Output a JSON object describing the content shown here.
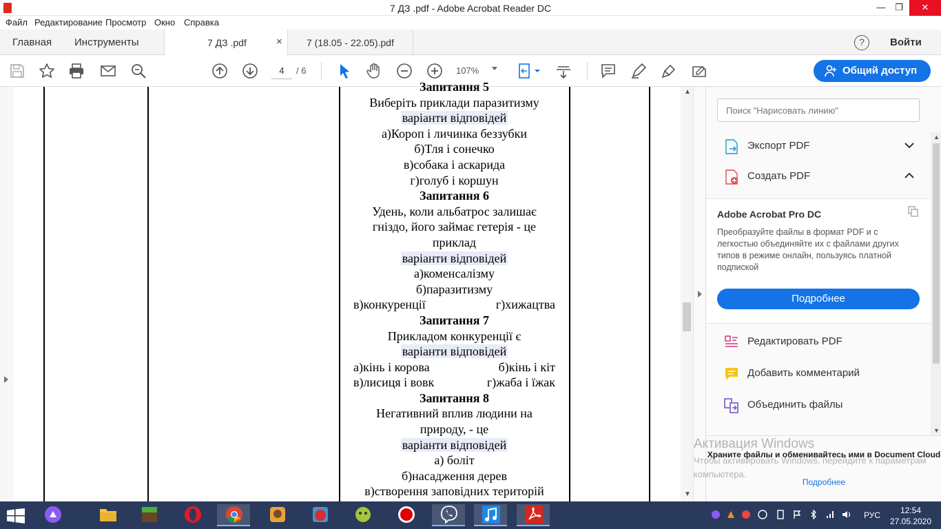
{
  "window": {
    "title": "7 ДЗ .pdf - Adobe Acrobat Reader DC"
  },
  "menu": [
    "Файл",
    "Редактирование",
    "Просмотр",
    "Окно",
    "Справка"
  ],
  "nav": {
    "home": "Главная",
    "tools": "Инструменты",
    "signin": "Войти",
    "help": "?"
  },
  "tabs": [
    {
      "label": "7 ДЗ .pdf",
      "close": "×"
    },
    {
      "label": "7 (18.05 - 22.05).pdf"
    }
  ],
  "toolbar": {
    "page_current": "4",
    "page_total": "/ 6",
    "zoom": "107%",
    "share_label": "Общий доступ"
  },
  "document": {
    "lines": [
      {
        "t": "Запитання 5",
        "b": true
      },
      {
        "t": "Виберіть приклади паразитизму"
      },
      {
        "t": "варіанти відповідей",
        "hl": true
      },
      {
        "t": "а)Короп і личинка беззубки"
      },
      {
        "t": "б)Тля і сонечко"
      },
      {
        "t": "в)собака і аскарида"
      },
      {
        "t": "г)голуб і коршун"
      },
      {
        "t": "Запитання 6",
        "b": true
      },
      {
        "t": "Удень, коли альбатрос залишає"
      },
      {
        "t": "гніздо, його займає гетерія - це"
      },
      {
        "t": "приклад"
      },
      {
        "t": "варіанти відповідей",
        "hl": true
      },
      {
        "t": "а)коменсалізму"
      },
      {
        "t": "б)паразитизму"
      },
      {
        "l": "в)конкуренції",
        "r": "г)хижацтва"
      },
      {
        "t": "Запитання 7",
        "b": true
      },
      {
        "t": "Прикладом конкуренції є"
      },
      {
        "t": "варіанти відповідей",
        "hl": true
      },
      {
        "l": "а)кінь і корова",
        "r": "б)кінь і кіт"
      },
      {
        "l": "в)лисиця і вовк",
        "r": "г)жаба і їжак"
      },
      {
        "t": "Запитання 8",
        "b": true
      },
      {
        "t": "Негативний вплив людини на"
      },
      {
        "t": "природу, - це"
      },
      {
        "t": "варіанти відповідей",
        "hl": true
      },
      {
        "t": "а) боліт"
      },
      {
        "t": "б)насадження дерев"
      },
      {
        "t": "в)створення заповідних територій"
      }
    ]
  },
  "right_panel": {
    "search_placeholder": "Поиск \"Нарисовать линию\"",
    "export_pdf": "Экспорт PDF",
    "create_pdf": "Создать PDF",
    "promo_title": "Adobe Acrobat Pro DC",
    "promo_desc": "Преобразуйте файлы в формат PDF и с легкостью объединяйте их с файлами других типов в режиме онлайн, пользуясь платной подпиской",
    "promo_button": "Подробнее",
    "edit_pdf": "Редактировать PDF",
    "add_comment": "Добавить комментарий",
    "combine_files": "Объединить файлы",
    "cloud_text": "Храните файлы и обменивайтесь ими в Document Cloud",
    "cloud_link": "Подробнее"
  },
  "watermark": {
    "line1": "Активация Windows",
    "line2": "Чтобы активировать Windows, перейдите к параметрам компьютера."
  },
  "taskbar": {
    "lang": "РУС",
    "time": "12:54",
    "date": "27.05.2020"
  },
  "colors": {
    "accent": "#1473e6",
    "taskbar": "#2a3a5c",
    "close": "#e81123"
  }
}
